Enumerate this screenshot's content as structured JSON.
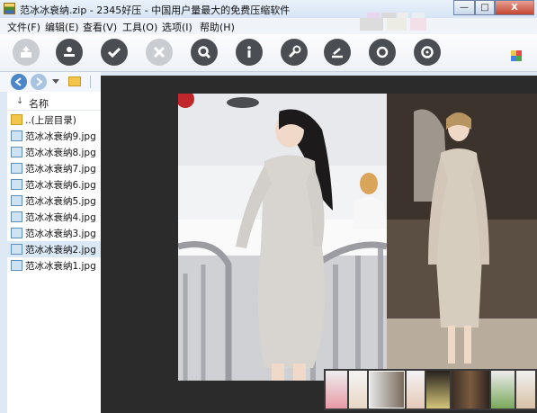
{
  "window": {
    "title": "范冰冰衰纳.zip - 2345好压 - 中国用户量最大的免费压缩软件",
    "minimize_glyph": "—",
    "maximize_glyph": "□",
    "close_glyph": "X"
  },
  "menu": {
    "items": [
      "文件(F)",
      "编辑(E)",
      "查看(V)",
      "工具(O)",
      "选项(I)",
      "帮助(H)"
    ]
  },
  "toolbar": {
    "icons": [
      "extract-icon",
      "add-icon",
      "check-icon",
      "delete-icon",
      "search-icon",
      "info-icon",
      "wrench-icon",
      "compress-icon",
      "refresh-icon",
      "disc-icon"
    ]
  },
  "file_list": {
    "column_header": "名称",
    "rows": [
      {
        "name": "..(上层目录)",
        "type": "folder"
      },
      {
        "name": "范冰冰衰纳9.jpg",
        "type": "jpg"
      },
      {
        "name": "范冰冰衰纳8.jpg",
        "type": "jpg"
      },
      {
        "name": "范冰冰衰纳7.jpg",
        "type": "jpg"
      },
      {
        "name": "范冰冰衰纳6.jpg",
        "type": "jpg"
      },
      {
        "name": "范冰冰衰纳5.jpg",
        "type": "jpg"
      },
      {
        "name": "范冰冰衰纳4.jpg",
        "type": "jpg"
      },
      {
        "name": "范冰冰衰纳3.jpg",
        "type": "jpg"
      },
      {
        "name": "范冰冰衰纳2.jpg",
        "type": "jpg"
      },
      {
        "name": "范冰冰衰纳1.jpg",
        "type": "jpg"
      }
    ]
  },
  "colors": {
    "accent": "#4a86c8",
    "viewer_bg": "#2b2b2b",
    "title_bar": "#d6e4f3"
  }
}
